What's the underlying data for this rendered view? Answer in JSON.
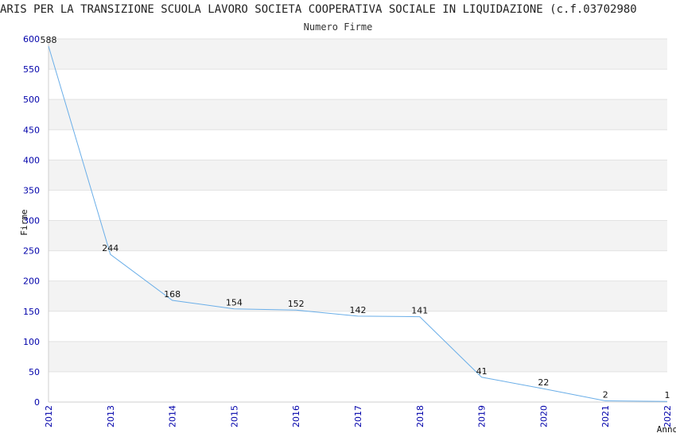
{
  "chart_data": {
    "type": "line",
    "title": "ARIS PER LA TRANSIZIONE SCUOLA LAVORO SOCIETA COOPERATIVA SOCIALE IN LIQUIDAZIONE (c.f.03702980",
    "subtitle": "Numero Firme",
    "xlabel": "Anno",
    "ylabel": "Firme",
    "categories": [
      "2012",
      "2013",
      "2014",
      "2015",
      "2016",
      "2017",
      "2018",
      "2019",
      "2020",
      "2021",
      "2022"
    ],
    "values": [
      588,
      244,
      168,
      154,
      152,
      142,
      141,
      41,
      22,
      2,
      1
    ],
    "ylim": [
      0,
      600
    ],
    "yticks": [
      0,
      50,
      100,
      150,
      200,
      250,
      300,
      350,
      400,
      450,
      500,
      550,
      600
    ],
    "grid": true,
    "colors": {
      "line": "#6aaee8",
      "band": "#f3f3f3",
      "tick": "#0000aa"
    }
  }
}
